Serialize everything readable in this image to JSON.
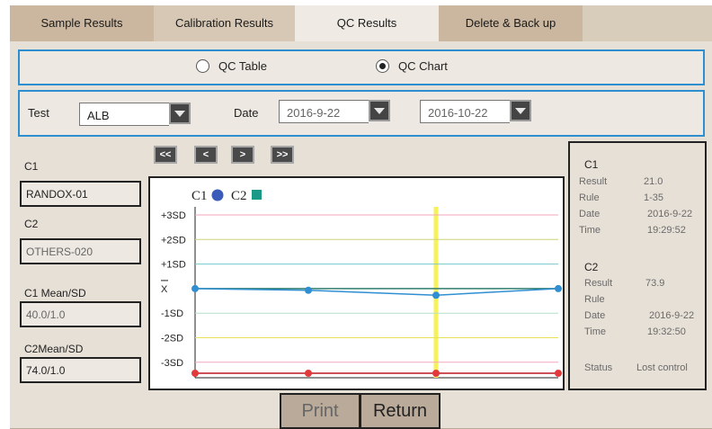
{
  "tabs": [
    "Sample Results",
    "Calibration Results",
    "QC Results",
    "Delete & Back up"
  ],
  "view_options": {
    "table": "QC Table",
    "chart": "QC Chart",
    "selected": "chart"
  },
  "filters": {
    "test_label": "Test",
    "test_value": "ALB",
    "date_label": "Date",
    "date_from": "2016-9-22",
    "date_to": "2016-10-22"
  },
  "controls": {
    "c1_label": "C1",
    "c1_value": "RANDOX-01",
    "c2_label": "C2",
    "c2_value": "OTHERS-020",
    "c1_mean_label": "C1 Mean/SD",
    "c1_mean_value": "40.0/1.0",
    "c2_mean_label": "C2Mean/SD",
    "c2_mean_value": "74.0/1.0"
  },
  "nav_buttons": [
    "<<",
    "<",
    ">",
    ">>"
  ],
  "chart_data": {
    "type": "line",
    "legend": [
      "C1",
      "C2"
    ],
    "y_labels": [
      "+3SD",
      "+2SD",
      "+1SD",
      "X",
      "-1SD",
      "-2SD",
      "-3SD"
    ],
    "y_range": [
      -3.5,
      3
    ],
    "series": [
      {
        "name": "C1",
        "color": "#2f8fd2",
        "x": [
          0,
          1,
          2,
          3
        ],
        "values": [
          0,
          -0.07,
          -0.27,
          0
        ]
      },
      {
        "name": "C2",
        "color": "#e23a3a",
        "x": [
          0,
          1,
          2,
          3
        ],
        "values": [
          -3.5,
          -3.5,
          -3.5,
          -3.5
        ]
      }
    ],
    "highlight_x": 2,
    "sd_line_colors": {
      "+3SD": "#f2a7bd",
      "+2SD": "#cfd37a",
      "+1SD": "#78c8c8",
      "X": "#2f7d6e",
      "-1SD": "#b7dfc7",
      "-2SD": "#e8e15a",
      "-3SD": "#f2a7bd"
    },
    "highlight_color": "#f6f25c"
  },
  "info": {
    "c1_head": "C1",
    "c1_rows": [
      [
        "Result",
        "21.0"
      ],
      [
        "Rule",
        "1-35"
      ],
      [
        "Date",
        "2016-9-22"
      ],
      [
        "Time",
        "19:29:52"
      ]
    ],
    "c2_head": "C2",
    "c2_rows": [
      [
        "Result",
        "73.9"
      ],
      [
        "Rule",
        ""
      ],
      [
        "Date",
        "2016-9-22"
      ],
      [
        "Time",
        "19:32:50"
      ]
    ],
    "status_label": "Status",
    "status_value": "Lost control"
  },
  "buttons": {
    "print": "Print",
    "return": "Return"
  }
}
